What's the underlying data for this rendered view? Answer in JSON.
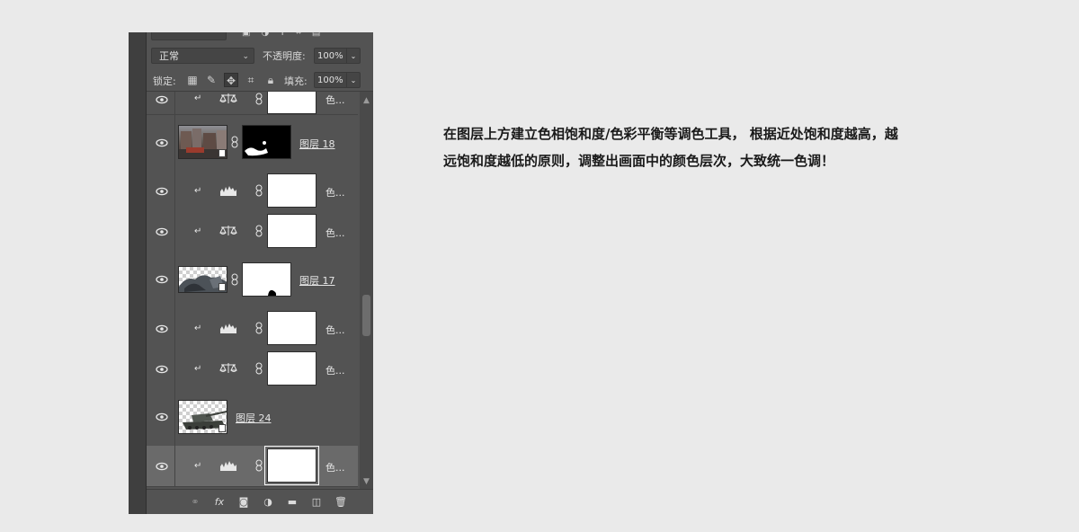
{
  "panel": {
    "blend_mode": "正常",
    "opacity_label": "不透明度:",
    "opacity_value": "100%",
    "lock_label": "锁定:",
    "fill_label": "填充:",
    "fill_value": "100%"
  },
  "layers": [
    {
      "kind": "adjustment",
      "adjustment": "color-balance",
      "name": "色...",
      "clipped": true,
      "partial": true
    },
    {
      "kind": "smart",
      "name": "图层 18",
      "mask": "black-with-white-spots"
    },
    {
      "kind": "adjustment",
      "adjustment": "levels",
      "name": "色...",
      "clipped": true
    },
    {
      "kind": "adjustment",
      "adjustment": "color-balance",
      "name": "色...",
      "clipped": true
    },
    {
      "kind": "smart",
      "name": "图层 17",
      "mask": "white-with-black-spot"
    },
    {
      "kind": "adjustment",
      "adjustment": "levels",
      "name": "色...",
      "clipped": true
    },
    {
      "kind": "adjustment",
      "adjustment": "color-balance",
      "name": "色...",
      "clipped": true
    },
    {
      "kind": "smart-nomask",
      "name": "图层 24"
    },
    {
      "kind": "adjustment",
      "adjustment": "levels",
      "name": "色...",
      "clipped": true,
      "selected": true
    }
  ],
  "bottom_icons": [
    "link-icon",
    "fx-icon",
    "add-mask-icon",
    "adjustment-icon",
    "folder-icon",
    "new-layer-icon",
    "trash-icon"
  ],
  "fx_label": "fx",
  "description": {
    "line1": "在图层上方建立色相饱和度/色彩平衡等调色工具，  根据近处饱和度越高，越",
    "line2": "远饱和度越低的原则，调整出画面中的颜色层次，大致统一色调！"
  },
  "colors": {
    "panel": "#535353",
    "selected_row": "#6a6a6a",
    "page_bg": "#eaeaea"
  }
}
